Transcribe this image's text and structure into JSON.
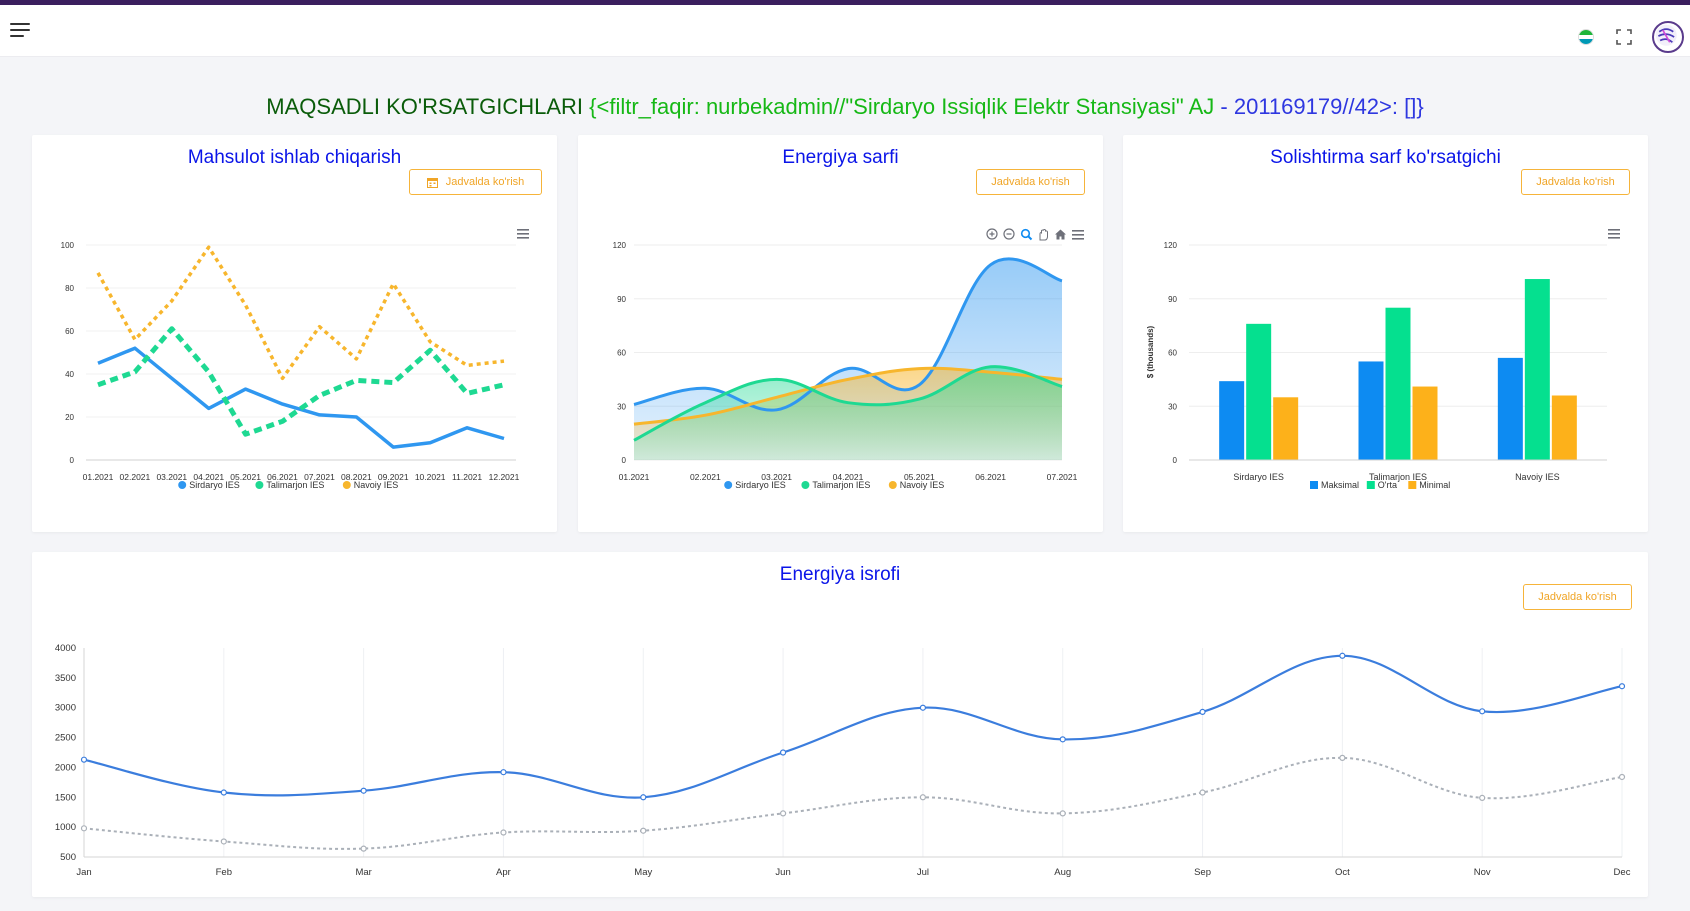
{
  "header": {
    "menu_icon": "hamburger-menu-icon",
    "flag_icon": "uzbekistan-flag-icon",
    "flag_colors": [
      "#1eb53a",
      "#ffffff",
      "#0099b5"
    ],
    "fullscreen_icon": "fullscreen-icon",
    "avatar_icon": "user-avatar-icon"
  },
  "page_title": {
    "part1": "MAQSADLI KO'RSATGICHLARI",
    "part2": " {<filtr_faqir: nurbekadmin//\"Sirdaryo Issiqlik Elektr Stansiyasi\" AJ",
    "part3": " - 201169179//42>: []}",
    "colors": [
      "#0a5c0a",
      "#16b816",
      "#2e37e0"
    ]
  },
  "colors": {
    "blue": "#2f97f0",
    "green": "#1ed992",
    "orange": "#f7b62d",
    "bar_blue": "#0d8bf2",
    "bar_green": "#05e08f",
    "bar_orange": "#fdb11a",
    "line_blue": "#3b7ddd",
    "line_gray": "#aab0b8",
    "title_blue": "#0b15e8",
    "button_orange": "#f0a526"
  },
  "cards": {
    "production": {
      "title": "Mahsulot ishlab chiqarish",
      "button": "Jadvalda ko'rish",
      "button_icon": "calendar-icon",
      "menu_icon": "chart-menu-icon"
    },
    "consumption": {
      "title": "Energiya sarfi",
      "button": "Jadvalda ko'rish",
      "toolbar_icons": [
        "zoom-in-icon",
        "zoom-out-icon",
        "magnifier-icon",
        "pan-hand-icon",
        "home-reset-icon",
        "chart-menu-icon"
      ]
    },
    "specific": {
      "title": "Solishtirma sarf ko'rsatgichi",
      "button": "Jadvalda ko'rish",
      "menu_icon": "chart-menu-icon"
    },
    "loss": {
      "title": "Energiya isrofi",
      "button": "Jadvalda ko'rish"
    }
  },
  "chart_data": [
    {
      "type": "line",
      "title": "Mahsulot ishlab chiqarish",
      "categories": [
        "01.2021",
        "02.2021",
        "03.2021",
        "04.2021",
        "05.2021",
        "06.2021",
        "07.2021",
        "08.2021",
        "09.2021",
        "10.2021",
        "11.2021",
        "12.2021"
      ],
      "series": [
        {
          "name": "Sirdaryo IES",
          "values": [
            45,
            52,
            38,
            24,
            33,
            26,
            21,
            20,
            6,
            8,
            15,
            10
          ]
        },
        {
          "name": "Talimarjon IES",
          "values": [
            35,
            41,
            61,
            41,
            12,
            18,
            30,
            37,
            36,
            51,
            31,
            35
          ]
        },
        {
          "name": "Navoiy IES",
          "values": [
            87,
            56,
            74,
            99,
            72,
            38,
            62,
            47,
            82,
            55,
            44,
            46
          ]
        }
      ],
      "yticks": [
        0,
        20,
        40,
        60,
        80,
        100
      ],
      "ylim": [
        0,
        100
      ],
      "legend": "bottom"
    },
    {
      "type": "area",
      "title": "Energiya sarfi",
      "categories": [
        "01.2021",
        "02.2021",
        "03.2021",
        "04.2021",
        "05.2021",
        "06.2021",
        "07.2021"
      ],
      "series": [
        {
          "name": "Sirdaryo IES",
          "values": [
            31,
            40,
            28,
            51,
            42,
            109,
            100
          ]
        },
        {
          "name": "Talimarjon IES",
          "values": [
            11,
            32,
            45,
            32,
            34,
            52,
            41
          ]
        },
        {
          "name": "Navoiy IES",
          "values": [
            20,
            25,
            35,
            45,
            51,
            49,
            45
          ]
        }
      ],
      "yticks": [
        0,
        30,
        60,
        90,
        120
      ],
      "ylim": [
        0,
        120
      ],
      "legend": "bottom"
    },
    {
      "type": "bar",
      "title": "Solishtirma sarf ko'rsatgichi",
      "categories": [
        "Sirdaryo IES",
        "Talimarjon IES",
        "Navoiy IES"
      ],
      "series": [
        {
          "name": "Maksimal",
          "values": [
            44,
            55,
            57
          ]
        },
        {
          "name": "O'rta",
          "values": [
            76,
            85,
            101
          ]
        },
        {
          "name": "Minimal",
          "values": [
            35,
            41,
            36
          ]
        }
      ],
      "ylabel": "$ (thousands)",
      "yticks": [
        0,
        30,
        60,
        90,
        120
      ],
      "ylim": [
        0,
        120
      ],
      "legend": "bottom"
    },
    {
      "type": "line",
      "title": "Energiya isrofi",
      "categories": [
        "Jan",
        "Feb",
        "Mar",
        "Apr",
        "May",
        "Jun",
        "Jul",
        "Aug",
        "Sep",
        "Oct",
        "Nov",
        "Dec"
      ],
      "series": [
        {
          "values": [
            2130,
            1580,
            1610,
            1920,
            1500,
            2250,
            3000,
            2470,
            2930,
            3870,
            2940,
            3360
          ]
        },
        {
          "values": [
            980,
            760,
            640,
            910,
            940,
            1230,
            1500,
            1230,
            1580,
            2160,
            1490,
            1840
          ]
        }
      ],
      "yticks": [
        500,
        1000,
        1500,
        2000,
        2500,
        3000,
        3500,
        4000
      ],
      "ylim": [
        500,
        4000
      ]
    }
  ]
}
